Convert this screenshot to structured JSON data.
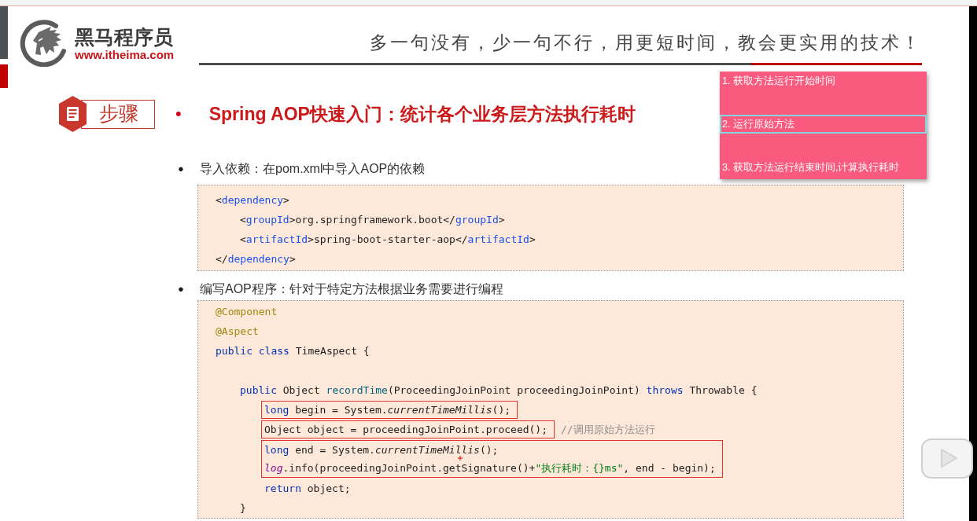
{
  "header": {
    "brand_name": "黑马程序员",
    "brand_url": "www.itheima.com",
    "slogan": "多一句没有，少一句不行，用更短时间，教会更实用的技术！"
  },
  "section": {
    "badge": "步骤",
    "bullet": "•",
    "title": "Spring AOP快速入门：统计各个业务层方法执行耗时"
  },
  "steps_popup": [
    {
      "text": "1. 获取方法运行开始时间",
      "selected": false
    },
    {
      "text": "2. 运行原始方法",
      "selected": true
    },
    {
      "text": "3. 获取方法运行结束时间,计算执行耗时",
      "selected": false
    }
  ],
  "bullets": [
    {
      "marker": "●",
      "text": "导入依赖：在pom.xml中导入AOP的依赖",
      "code": [
        {
          "kind": "line",
          "tokens": [
            {
              "text": "<",
              "kind": "plain"
            },
            {
              "text": "dependency",
              "kind": "tag"
            },
            {
              "text": ">",
              "kind": "plain"
            }
          ],
          "children": [
            {
              "kind": "line",
              "tokens": [
                {
                  "text": "<",
                  "kind": "plain"
                },
                {
                  "text": "groupId",
                  "kind": "tag"
                },
                {
                  "text": ">org.springframework.boot</",
                  "kind": "plain"
                },
                {
                  "text": "groupId",
                  "kind": "tag"
                },
                {
                  "text": ">",
                  "kind": "plain"
                }
              ]
            },
            {
              "kind": "line",
              "tokens": [
                {
                  "text": "<",
                  "kind": "plain"
                },
                {
                  "text": "artifactId",
                  "kind": "tag"
                },
                {
                  "text": ">spring-boot-starter-aop</",
                  "kind": "plain"
                },
                {
                  "text": "artifactId",
                  "kind": "tag"
                },
                {
                  "text": ">",
                  "kind": "plain"
                }
              ]
            }
          ]
        },
        {
          "kind": "line",
          "tokens": [
            {
              "text": "</",
              "kind": "plain"
            },
            {
              "text": "dependency",
              "kind": "tag"
            },
            {
              "text": ">",
              "kind": "plain"
            }
          ]
        }
      ]
    },
    {
      "marker": "●",
      "text": "编写AOP程序：针对于特定方法根据业务需要进行编程",
      "code": [
        {
          "kind": "line",
          "tokens": [
            {
              "text": "@Component",
              "kind": "annotation"
            }
          ]
        },
        {
          "kind": "line",
          "tokens": [
            {
              "text": "@Aspect",
              "kind": "annotation"
            }
          ]
        },
        {
          "kind": "line",
          "tokens": [
            {
              "text": "public class",
              "kind": "keyword"
            },
            {
              "text": " TimeAspect {",
              "kind": "plain"
            }
          ],
          "children": [
            {
              "kind": "blank"
            },
            {
              "kind": "line",
              "tokens": [
                {
                  "text": "public",
                  "kind": "keyword"
                },
                {
                  "text": " Object ",
                  "kind": "plain"
                },
                {
                  "text": "recordTime",
                  "kind": "method"
                },
                {
                  "text": "(ProceedingJoinPoint proceedingJoinPoint) ",
                  "kind": "plain"
                },
                {
                  "text": "throws",
                  "kind": "keyword"
                },
                {
                  "text": " Throwable {",
                  "kind": "plain"
                }
              ],
              "children": [
                {
                  "kind": "highlight",
                  "lines": [
                    {
                      "tokens": [
                        {
                          "text": "long",
                          "kind": "keyword"
                        },
                        {
                          "text": " begin = System.",
                          "kind": "plain"
                        },
                        {
                          "text": "currentTimeMillis",
                          "kind": "static_call"
                        },
                        {
                          "text": "();",
                          "kind": "plain"
                        }
                      ]
                    }
                  ]
                },
                {
                  "kind": "highlight",
                  "lines": [
                    {
                      "tokens": [
                        {
                          "text": "Object object = proceedingJoinPoint.proceed();",
                          "kind": "plain"
                        }
                      ]
                    }
                  ],
                  "after": [
                    {
                      "text": "//调用原始方法运行",
                      "kind": "comment"
                    }
                  ]
                },
                {
                  "kind": "highlight",
                  "lines": [
                    {
                      "tokens": [
                        {
                          "text": "long",
                          "kind": "keyword"
                        },
                        {
                          "text": " end = System.",
                          "kind": "plain"
                        },
                        {
                          "text": "currentTimeMillis",
                          "kind": "static_call"
                        },
                        {
                          "text": "();",
                          "kind": "plain"
                        }
                      ]
                    },
                    {
                      "tokens": [
                        {
                          "text": "log",
                          "kind": "static_field"
                        },
                        {
                          "text": ".info(proceedingJoinPoint.getSignature()+",
                          "kind": "plain"
                        },
                        {
                          "text": "\"执行耗时：{}ms\"",
                          "kind": "string"
                        },
                        {
                          "text": ", end - begin);",
                          "kind": "plain"
                        }
                      ]
                    }
                  ]
                },
                {
                  "kind": "line",
                  "tokens": [
                    {
                      "text": "return",
                      "kind": "keyword"
                    },
                    {
                      "text": " object;",
                      "kind": "plain"
                    }
                  ]
                }
              ]
            },
            {
              "kind": "line",
              "tokens": [
                {
                  "text": "}",
                  "kind": "plain"
                }
              ]
            }
          ]
        }
      ]
    }
  ]
}
